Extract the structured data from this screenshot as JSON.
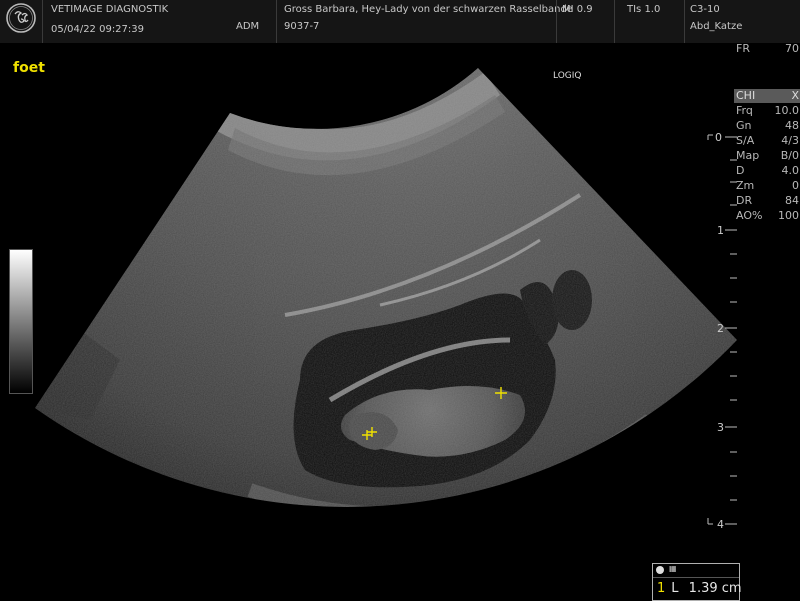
{
  "header": {
    "clinic": "VETIMAGE DIAGNOSTIK",
    "datetime": "05/04/22 09:27:39",
    "operator": "ADM",
    "patient": "Gross Barbara, Hey-Lady von der schwarzen Rasselbande",
    "patient_id": "9037-7",
    "mi": "MI 0.9",
    "tis": "TIs 1.0",
    "probe": "C3-10",
    "preset": "Abd_Katze"
  },
  "logo_icon": "ge-logo",
  "annotation": "foet",
  "brand_mark": "LOGIQ",
  "params": [
    {
      "k": "FR",
      "v": "70"
    },
    {
      "k": "CHI",
      "v": "X"
    },
    {
      "k": "Frq",
      "v": "10.0"
    },
    {
      "k": "Gn",
      "v": "48"
    },
    {
      "k": "S/A",
      "v": "4/3"
    },
    {
      "k": "Map",
      "v": "B/0"
    },
    {
      "k": "D",
      "v": "4.0"
    },
    {
      "k": "Zm",
      "v": "0"
    },
    {
      "k": "DR",
      "v": "84"
    },
    {
      "k": "AO%",
      "v": "100"
    }
  ],
  "depth_scale": [
    "0",
    "1",
    "2",
    "3",
    "4"
  ],
  "measurement": {
    "index": "1",
    "type": "L",
    "value": "1.39 cm",
    "icon": "measure-settings-icon"
  },
  "colors": {
    "accent_yellow": "#f0e100",
    "background": "#000000",
    "header_bg": "#151515"
  }
}
